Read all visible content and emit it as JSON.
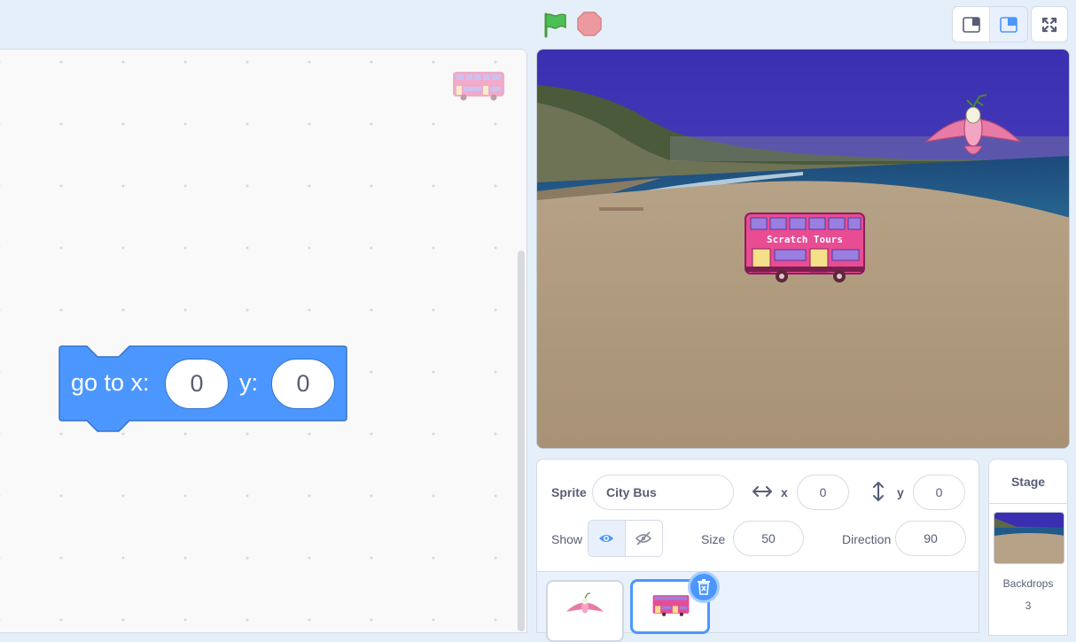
{
  "code_block": {
    "opcode_part1": "go to x:",
    "x_value": "0",
    "opcode_part2": "y:",
    "y_value": "0"
  },
  "sprite_info": {
    "sprite_label": "Sprite",
    "sprite_name": "City Bus",
    "x_label": "x",
    "x_value": "0",
    "y_label": "y",
    "y_value": "0",
    "show_label": "Show",
    "size_label": "Size",
    "size_value": "50",
    "direction_label": "Direction",
    "direction_value": "90"
  },
  "bus_sign": "Scratch Tours",
  "stage_pane": {
    "title": "Stage",
    "backdrops_label": "Backdrops",
    "backdrops_count": "3"
  },
  "colors": {
    "block_blue": "#4c97ff",
    "accent": "#4c97ff",
    "flag_green": "#4cbf56",
    "stop_red": "#ec9a9f",
    "bus_pink": "#e84c93"
  }
}
